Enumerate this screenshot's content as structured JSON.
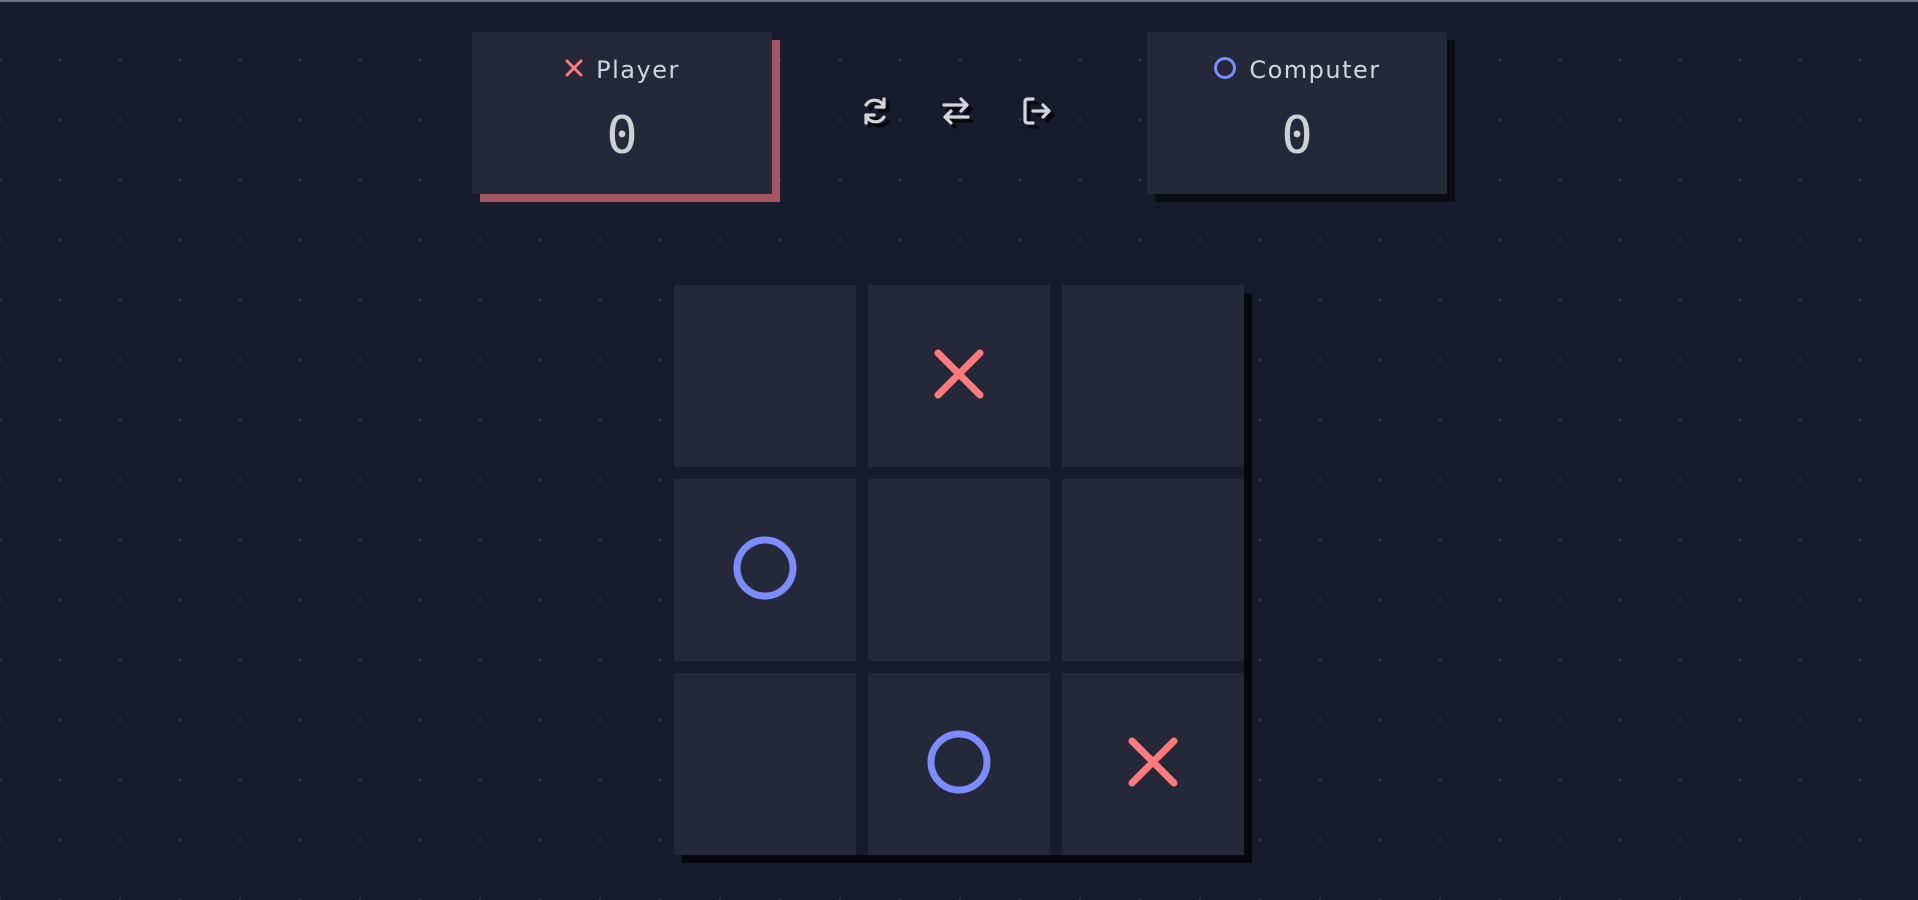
{
  "scoreboard": {
    "player": {
      "name": "Player",
      "mark": "X",
      "score": "0",
      "active": true
    },
    "computer": {
      "name": "Computer",
      "mark": "O",
      "score": "0",
      "active": false
    }
  },
  "controls": [
    {
      "id": "restart",
      "icon": "restart-icon"
    },
    {
      "id": "swap",
      "icon": "swap-arrows-icon"
    },
    {
      "id": "exit",
      "icon": "exit-icon"
    }
  ],
  "board": {
    "cells": [
      "",
      "X",
      "",
      "O",
      "",
      "",
      "",
      "O",
      "X"
    ]
  },
  "colors": {
    "background": "#181b2c",
    "cell": "#242839",
    "x_mark": "#ff7b7b",
    "o_mark": "#7b8cff",
    "active_shadow": "#a35662",
    "text": "#d4d4dc"
  }
}
